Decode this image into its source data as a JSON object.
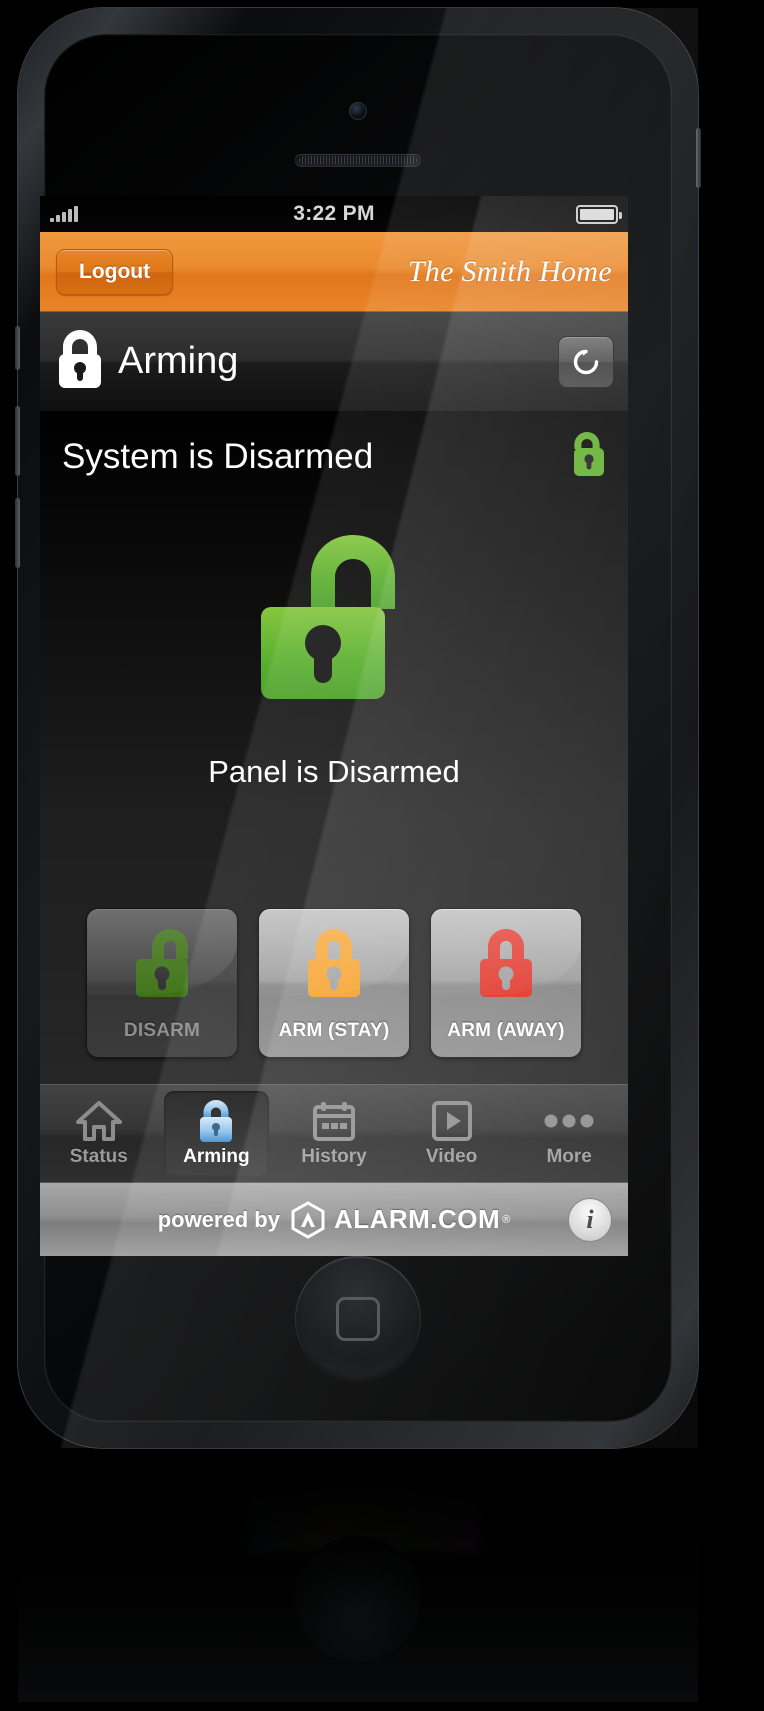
{
  "device": {
    "status_bar": {
      "carrier_signal_icon": "signal-bars-icon",
      "signal_bars": 5,
      "time": "3:22 PM",
      "battery_icon": "battery-icon",
      "battery_level_percent": 90
    }
  },
  "top_bar": {
    "logout_label": "Logout",
    "home_name": "The Smith Home",
    "accent_color": "#e9862a"
  },
  "section_header": {
    "lock_icon": "lock-closed-icon",
    "title": "Arming",
    "refresh_icon": "refresh-icon"
  },
  "arming": {
    "system_status": "System is Disarmed",
    "status_lock_icon": "lock-open-icon",
    "status_lock_color": "#5fae2b",
    "big_lock_icon": "lock-open-large-icon",
    "big_lock_color": "#65b72e",
    "panel_status": "Panel is Disarmed",
    "buttons": [
      {
        "label": "DISARM",
        "icon": "lock-open-icon",
        "icon_color": "#3c7114",
        "state": "disabled"
      },
      {
        "label": "ARM (STAY)",
        "icon": "lock-closed-icon",
        "icon_color": "#f59b1c",
        "state": "enabled"
      },
      {
        "label": "ARM (AWAY)",
        "icon": "lock-closed-icon",
        "icon_color": "#e02b20",
        "state": "enabled"
      }
    ]
  },
  "tab_bar": {
    "items": [
      {
        "label": "Status",
        "icon": "home-icon",
        "selected": false
      },
      {
        "label": "Arming",
        "icon": "lock-icon",
        "selected": true
      },
      {
        "label": "History",
        "icon": "calendar-icon",
        "selected": false
      },
      {
        "label": "Video",
        "icon": "play-icon",
        "selected": false
      },
      {
        "label": "More",
        "icon": "ellipsis-icon",
        "selected": false
      }
    ],
    "selected_icon_color": "#7ab8e8"
  },
  "footer": {
    "powered_by": "powered by",
    "brand": "ALARM.COM",
    "brand_mark": "alarm-com-logo-icon",
    "trademark": "®",
    "info_icon": "info-icon"
  }
}
